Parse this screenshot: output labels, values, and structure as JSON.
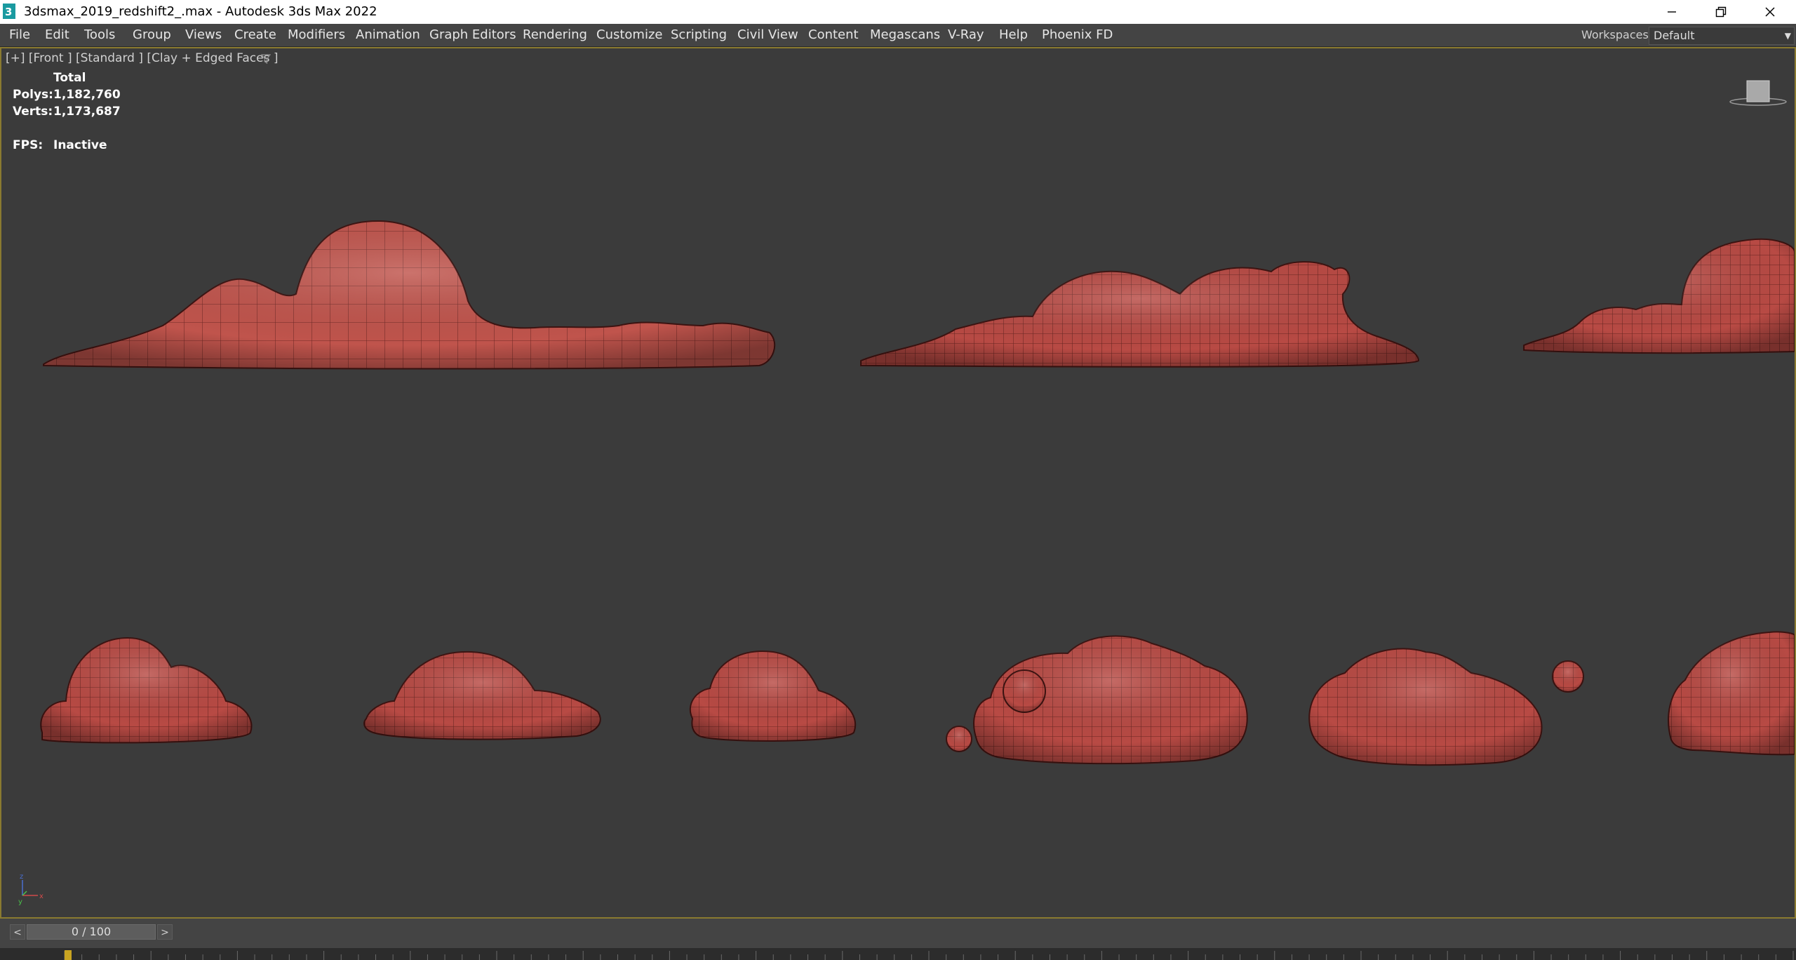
{
  "window": {
    "title": "3dsmax_2019_redshift2_.max - Autodesk 3ds Max 2022",
    "controls": [
      "minimize-icon",
      "restore-icon",
      "close-icon"
    ]
  },
  "menubar": {
    "items": [
      {
        "label": "File"
      },
      {
        "label": "Edit"
      },
      {
        "label": "Tools"
      },
      {
        "label": "Group"
      },
      {
        "label": "Views"
      },
      {
        "label": "Create"
      },
      {
        "label": "Modifiers"
      },
      {
        "label": "Animation"
      },
      {
        "label": "Graph Editors"
      },
      {
        "label": "Rendering"
      },
      {
        "label": "Customize"
      },
      {
        "label": "Scripting"
      },
      {
        "label": "Civil View"
      },
      {
        "label": "Content"
      },
      {
        "label": "Megascans"
      },
      {
        "label": "V-Ray"
      },
      {
        "label": "Help"
      },
      {
        "label": "Phoenix FD"
      }
    ],
    "workspaces_label": "Workspaces:",
    "workspace_value": "Default"
  },
  "viewport": {
    "label": "[+] [Front ] [Standard ] [Clay + Edged Faces ]",
    "stats": {
      "header": "Total",
      "polys_label": "Polys:",
      "polys_value": "1,182,760",
      "verts_label": "Verts:",
      "verts_value": "1,173,687",
      "fps_label": "FPS:",
      "fps_value": "Inactive"
    },
    "viewcube_icon": "viewcube-icon",
    "axis_gizmo_icon": "axis-gizmo-icon",
    "mesh_color": "#b84a44"
  },
  "timeline": {
    "prev_label": "<",
    "next_label": ">",
    "frame_display": "0 / 100"
  },
  "colors": {
    "viewport_bg": "#3b3b3b",
    "menubar_bg": "#444444",
    "active_border": "#8a7a30",
    "time_handle": "#c9a421"
  }
}
